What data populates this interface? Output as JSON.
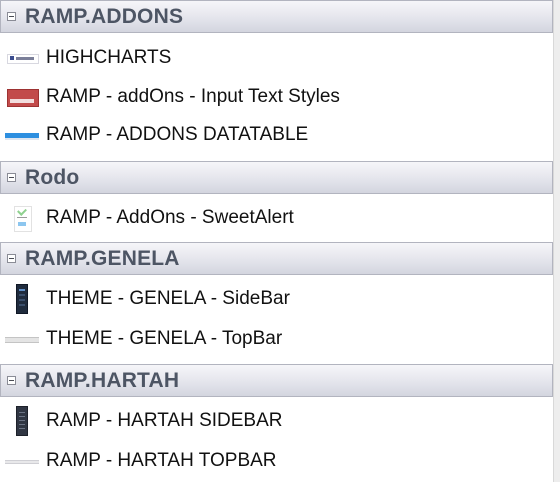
{
  "groups": [
    {
      "title": "RAMP.ADDONS",
      "items": [
        {
          "label": "HIGHCHARTS",
          "thumbnail": "highcharts-thumbnail"
        },
        {
          "label": "RAMP - addOns - Input Text Styles",
          "thumbnail": "input-text-styles-thumbnail"
        },
        {
          "label": "RAMP - ADDONS DATATABLE",
          "thumbnail": "datatable-thumbnail"
        }
      ]
    },
    {
      "title": "Rodo",
      "items": [
        {
          "label": "RAMP - AddOns - SweetAlert",
          "thumbnail": "sweetalert-thumbnail"
        }
      ]
    },
    {
      "title": "RAMP.GENELA",
      "items": [
        {
          "label": "THEME - GENELA - SideBar",
          "thumbnail": "genela-sidebar-thumbnail"
        },
        {
          "label": "THEME - GENELA - TopBar",
          "thumbnail": "genela-topbar-thumbnail"
        }
      ]
    },
    {
      "title": "RAMP.HARTAH",
      "items": [
        {
          "label": "RAMP - HARTAH SIDEBAR",
          "thumbnail": "hartah-sidebar-thumbnail"
        },
        {
          "label": "RAMP - HARTAH TOPBAR",
          "thumbnail": "hartah-topbar-thumbnail"
        }
      ]
    }
  ],
  "colors": {
    "header_text": "#4d5564",
    "header_border": "#b2b4bf",
    "item_text": "#111111"
  }
}
